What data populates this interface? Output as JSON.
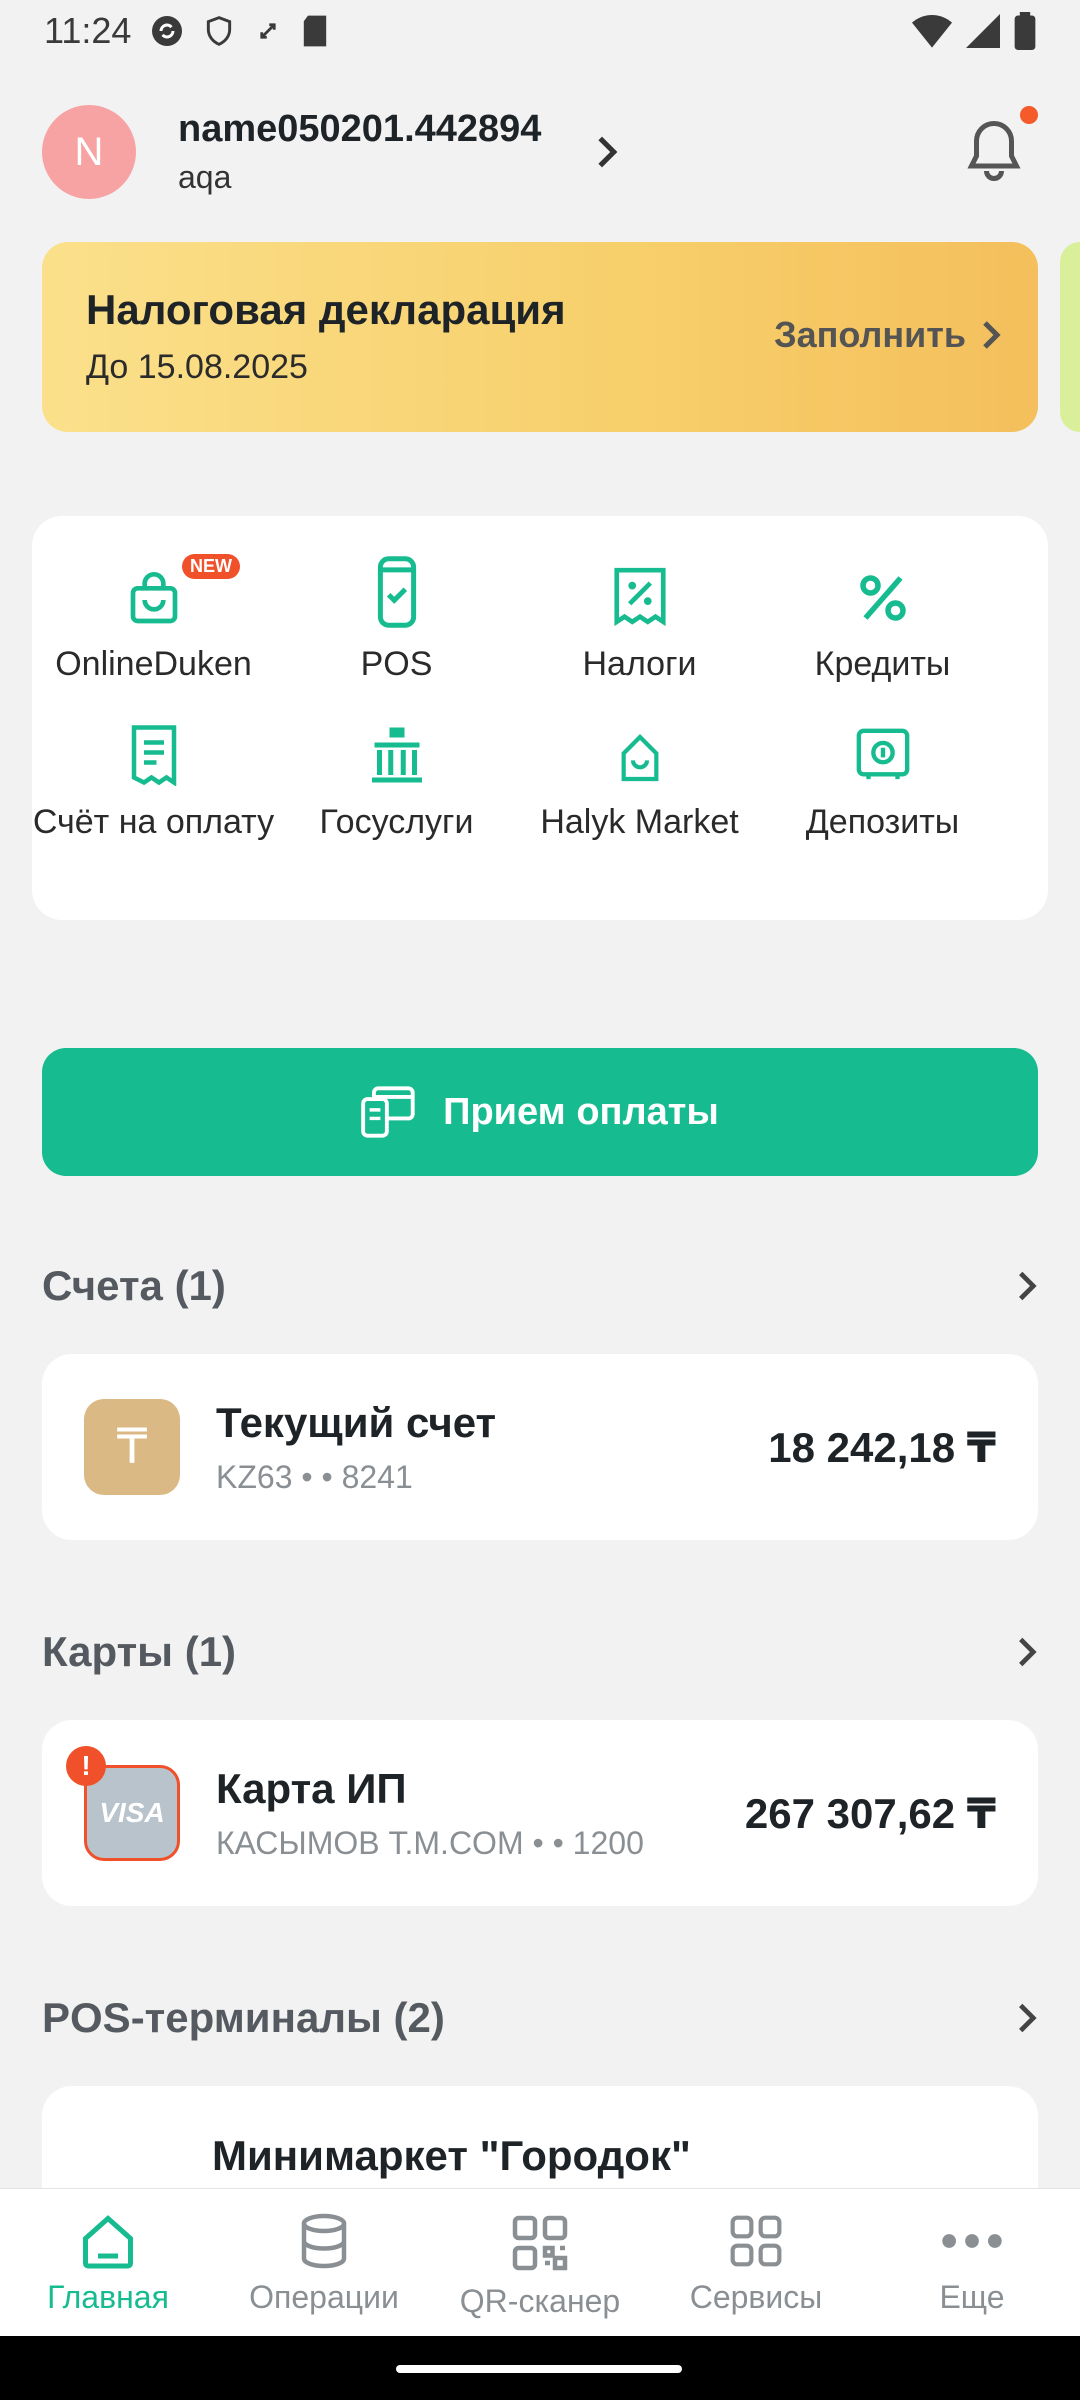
{
  "status_bar": {
    "time": "11:24"
  },
  "header": {
    "avatar_letter": "N",
    "user_name": "name050201.442894",
    "org": "aqa",
    "has_notification": true
  },
  "tax_banner": {
    "title": "Налоговая декларация",
    "date": "До 15.08.2025",
    "action": "Заполнить"
  },
  "services": {
    "row1": [
      {
        "label": "OnlineDuken",
        "icon": "shopping-bag-icon",
        "badge": "NEW"
      },
      {
        "label": "POS",
        "icon": "pos-terminal-icon"
      },
      {
        "label": "Налоги",
        "icon": "tax-receipt-icon"
      },
      {
        "label": "Кредиты",
        "icon": "percent-icon"
      }
    ],
    "row2": [
      {
        "label": "Счёт на оплату",
        "icon": "invoice-icon"
      },
      {
        "label": "Госуслуги",
        "icon": "government-building-icon"
      },
      {
        "label": "Halyk Market",
        "icon": "market-icon"
      },
      {
        "label": "Депозиты",
        "icon": "safe-icon"
      }
    ]
  },
  "pay_button": {
    "label": "Прием оплаты"
  },
  "accounts": {
    "heading": "Счета (1)",
    "items": [
      {
        "title": "Текущий счет",
        "sub": "KZ63 • • 8241",
        "amount": "18 242,18 ₸",
        "icon_letter": "₸"
      }
    ]
  },
  "cards": {
    "heading": "Карты (1)",
    "items": [
      {
        "title": "Карта ИП",
        "sub": "КАСЫМОВ Т.М.COM • • 1200",
        "amount": "267 307,62 ₸",
        "brand": "VISA",
        "alert": "!"
      }
    ]
  },
  "pos_terminals": {
    "heading": "POS-терминалы (2)",
    "items": [
      {
        "title": "Минимаркет \"Городок\""
      }
    ]
  },
  "bottom_nav": [
    {
      "label": "Главная",
      "icon": "home-icon",
      "active": true
    },
    {
      "label": "Операции",
      "icon": "database-icon"
    },
    {
      "label": "QR-сканер",
      "icon": "qr-icon"
    },
    {
      "label": "Сервисы",
      "icon": "grid-icon"
    },
    {
      "label": "Еще",
      "icon": "more-dots-icon"
    }
  ],
  "colors": {
    "accent": "#16bb8f",
    "alert": "#f0502a",
    "banner": "#f7cf6b"
  }
}
